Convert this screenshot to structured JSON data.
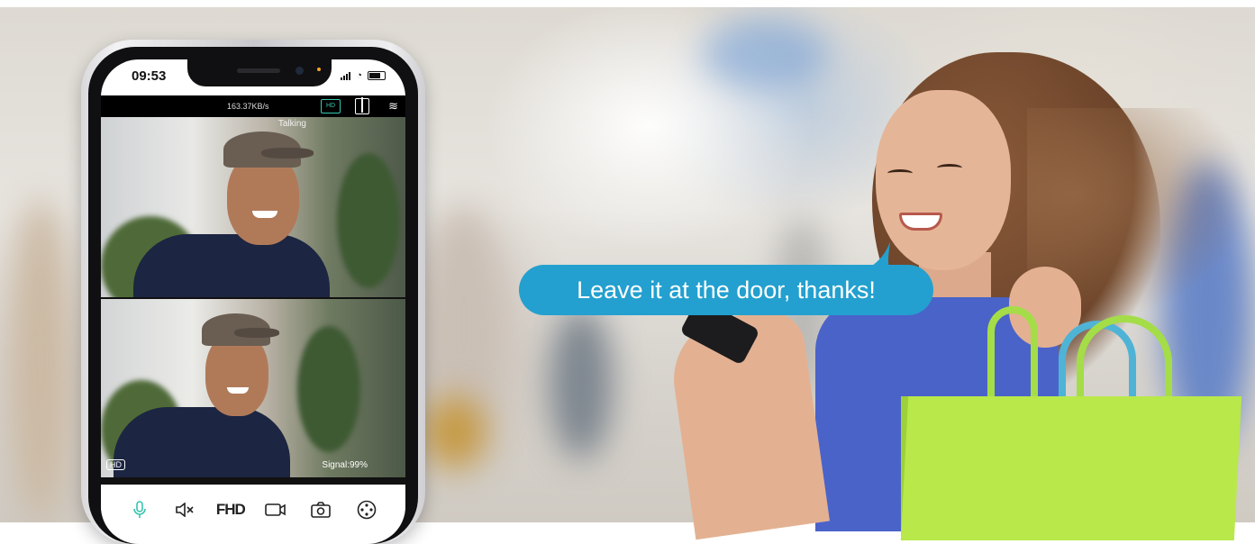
{
  "phone": {
    "time": "09:53",
    "speed": "163.37KB/s",
    "quality_chip": "HD",
    "talking_label": "Talking",
    "hd_badge": "HD",
    "signal": "Signal:99%",
    "toolbar": {
      "fhd_label": "FHD"
    }
  },
  "bubble": {
    "text": "Leave it at the door, thanks!"
  },
  "colors": {
    "bubble": "#23a0cf",
    "accent": "#35c7b0",
    "bag": "#b9e84b",
    "dress": "#4a63c9"
  },
  "icons": [
    "mic-icon",
    "mute-icon",
    "camera-switch-icon",
    "snapshot-icon",
    "settings-dial-icon",
    "split-view-icon",
    "wifi-icon"
  ]
}
